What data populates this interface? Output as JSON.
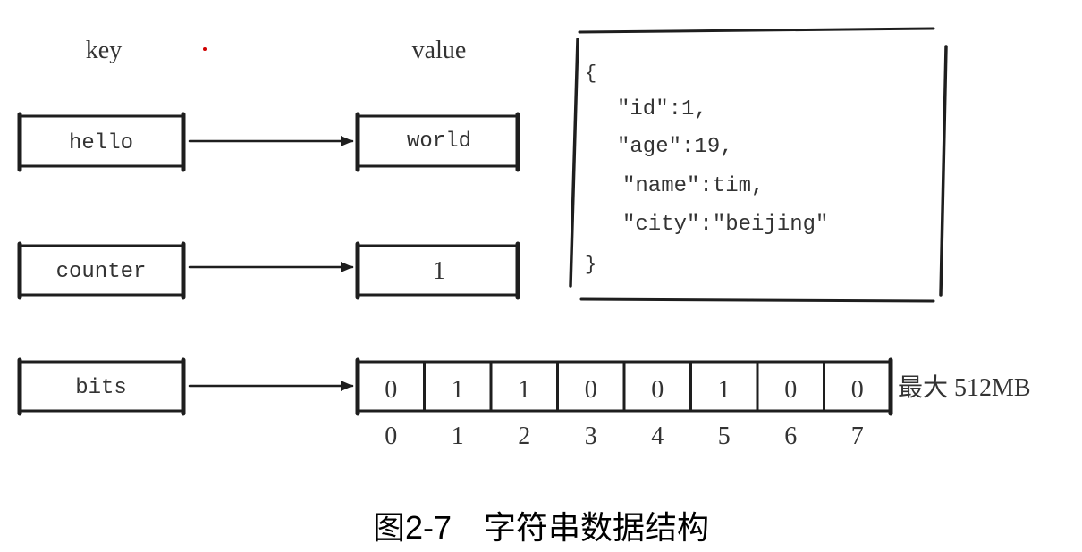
{
  "headers": {
    "key": "key",
    "value": "value"
  },
  "rows": [
    {
      "key": "hello",
      "value": "world"
    },
    {
      "key": "counter",
      "value": "1"
    },
    {
      "key": "bits"
    }
  ],
  "bits": {
    "values": [
      "0",
      "1",
      "1",
      "0",
      "0",
      "1",
      "0",
      "0"
    ],
    "indices": [
      "0",
      "1",
      "2",
      "3",
      "4",
      "5",
      "6",
      "7"
    ],
    "limit": "最大 512MB"
  },
  "json_box": {
    "lines": [
      "{",
      "\"id\":1,",
      "\"age\":19,",
      "\"name\":tim,",
      "\"city\":\"beijing\"",
      "}"
    ]
  },
  "caption": "图2-7　字符串数据结构",
  "colors": {
    "ink": "#1e1e1e",
    "text": "#333333",
    "dot": "#d00000"
  }
}
